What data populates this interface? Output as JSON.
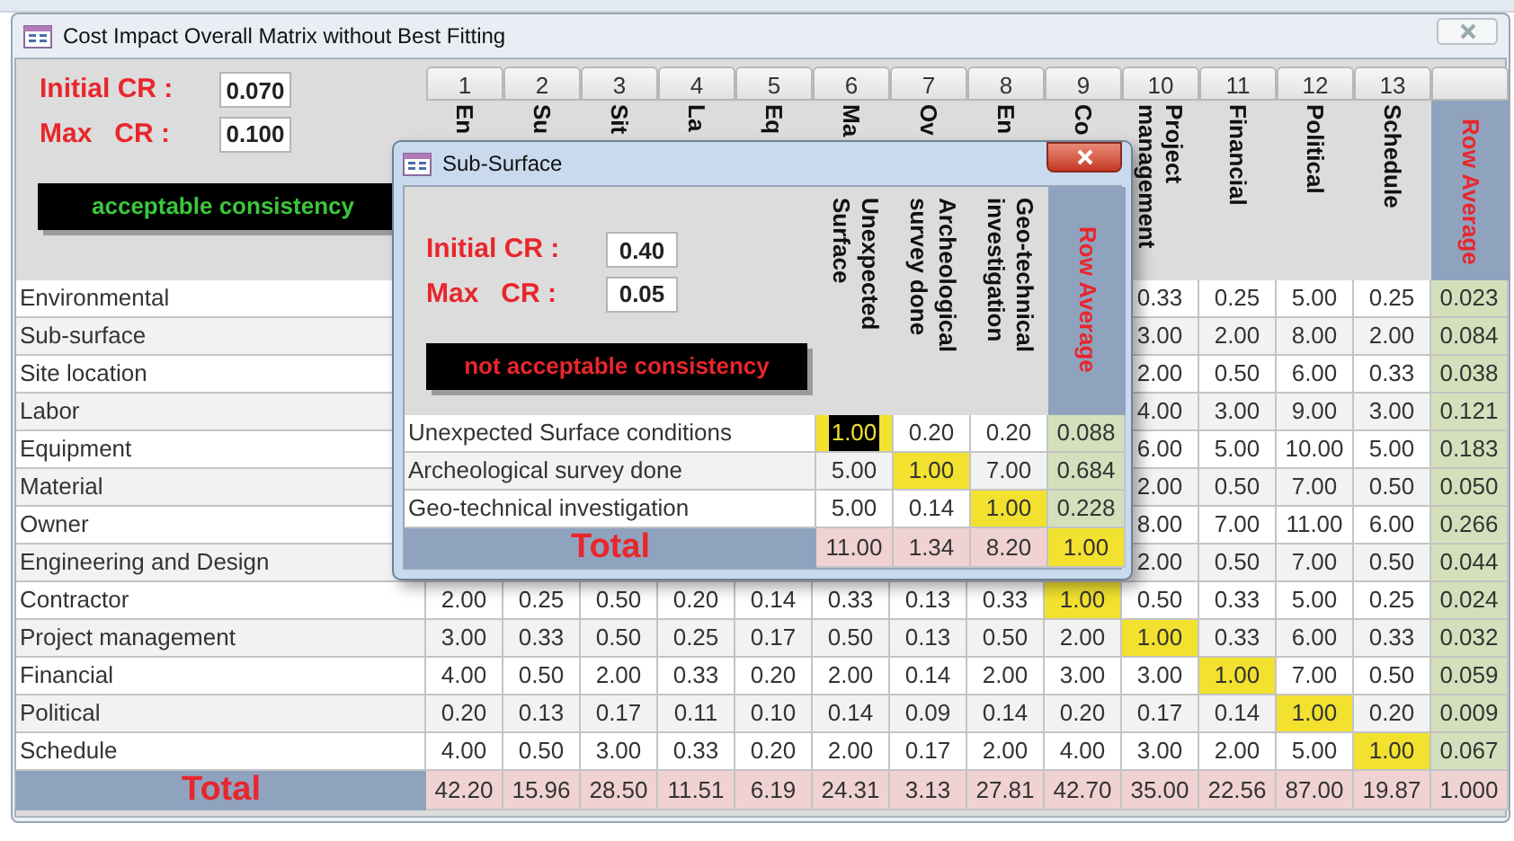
{
  "main_window": {
    "title": "Cost Impact Overall Matrix without Best Fitting",
    "initial_cr": {
      "label": "Initial CR :",
      "value": "0.070"
    },
    "max_cr": {
      "label": "Max   CR :",
      "value": "0.100"
    },
    "status": {
      "text": "acceptable consistency",
      "acceptable": true
    },
    "column_numbers": [
      "1",
      "2",
      "3",
      "4",
      "5",
      "6",
      "7",
      "8",
      "9",
      "10",
      "11",
      "12",
      "13"
    ],
    "columns": [
      "En",
      "Su",
      "Sit",
      "La",
      "Eq",
      "Ma",
      "Ov",
      "En",
      "Co",
      "Project management",
      "Financial",
      "Political",
      "Schedule"
    ],
    "average_header": "Row Average",
    "rows": [
      {
        "label": "Environmental",
        "cells": [
          null,
          null,
          null,
          null,
          null,
          null,
          null,
          null,
          null,
          "0.33",
          "0.25",
          "5.00",
          "0.25"
        ],
        "average": "0.023"
      },
      {
        "label": "Sub-surface",
        "cells": [
          null,
          null,
          null,
          null,
          null,
          null,
          null,
          null,
          null,
          "3.00",
          "2.00",
          "8.00",
          "2.00"
        ],
        "average": "0.084"
      },
      {
        "label": "Site location",
        "cells": [
          null,
          null,
          null,
          null,
          null,
          null,
          null,
          null,
          null,
          "2.00",
          "0.50",
          "6.00",
          "0.33"
        ],
        "average": "0.038"
      },
      {
        "label": "Labor",
        "cells": [
          null,
          null,
          null,
          null,
          null,
          null,
          null,
          null,
          null,
          "4.00",
          "3.00",
          "9.00",
          "3.00"
        ],
        "average": "0.121"
      },
      {
        "label": "Equipment",
        "cells": [
          null,
          null,
          null,
          null,
          null,
          null,
          null,
          null,
          null,
          "6.00",
          "5.00",
          "10.00",
          "5.00"
        ],
        "average": "0.183"
      },
      {
        "label": "Material",
        "cells": [
          null,
          null,
          null,
          null,
          null,
          null,
          null,
          null,
          null,
          "2.00",
          "0.50",
          "7.00",
          "0.50"
        ],
        "average": "0.050"
      },
      {
        "label": "Owner",
        "cells": [
          null,
          null,
          null,
          null,
          null,
          null,
          null,
          null,
          null,
          "8.00",
          "7.00",
          "11.00",
          "6.00"
        ],
        "average": "0.266"
      },
      {
        "label": "Engineering and Design",
        "cells": [
          null,
          null,
          null,
          null,
          null,
          null,
          null,
          null,
          null,
          "2.00",
          "0.50",
          "7.00",
          "0.50"
        ],
        "average": "0.044"
      },
      {
        "label": "Contractor",
        "cells": [
          "2.00",
          "0.25",
          "0.50",
          "0.20",
          "0.14",
          "0.33",
          "0.13",
          "0.33",
          "1.00",
          "0.50",
          "0.33",
          "5.00",
          "0.25"
        ],
        "average": "0.024"
      },
      {
        "label": "Project management",
        "cells": [
          "3.00",
          "0.33",
          "0.50",
          "0.25",
          "0.17",
          "0.50",
          "0.13",
          "0.50",
          "2.00",
          "1.00",
          "0.33",
          "6.00",
          "0.33"
        ],
        "average": "0.032"
      },
      {
        "label": "Financial",
        "cells": [
          "4.00",
          "0.50",
          "2.00",
          "0.33",
          "0.20",
          "2.00",
          "0.14",
          "2.00",
          "3.00",
          "3.00",
          "1.00",
          "7.00",
          "0.50"
        ],
        "average": "0.059"
      },
      {
        "label": "Political",
        "cells": [
          "0.20",
          "0.13",
          "0.17",
          "0.11",
          "0.10",
          "0.14",
          "0.09",
          "0.14",
          "0.20",
          "0.17",
          "0.14",
          "1.00",
          "0.20"
        ],
        "average": "0.009"
      },
      {
        "label": "Schedule",
        "cells": [
          "4.00",
          "0.50",
          "3.00",
          "0.33",
          "0.20",
          "2.00",
          "0.17",
          "2.00",
          "4.00",
          "3.00",
          "2.00",
          "5.00",
          "1.00"
        ],
        "average": "0.067"
      }
    ],
    "total": {
      "label": "Total",
      "cells": [
        "42.20",
        "15.96",
        "28.50",
        "11.51",
        "6.19",
        "24.31",
        "3.13",
        "27.81",
        "42.70",
        "35.00",
        "22.56",
        "87.00",
        "19.87"
      ],
      "average": "1.000",
      "average_highlighted": false
    }
  },
  "dialog": {
    "title": "Sub-Surface",
    "initial_cr": {
      "label": "Initial CR :",
      "value": "0.40"
    },
    "max_cr": {
      "label": "Max   CR :",
      "value": "0.05"
    },
    "status": {
      "text": "not acceptable consistency",
      "acceptable": false
    },
    "columns": [
      "Unexpected Surface",
      "Archeological survey done",
      "Geo-technical investigation"
    ],
    "average_header": "Row Average",
    "rows": [
      {
        "label": "Unexpected Surface conditions",
        "cells": [
          {
            "value": "1.00",
            "selected": true
          },
          {
            "value": "0.20",
            "selected": false
          },
          {
            "value": "0.20",
            "selected": false
          }
        ],
        "average": "0.088"
      },
      {
        "label": "Archeological survey done",
        "cells": [
          {
            "value": "5.00",
            "selected": false
          },
          {
            "value": "1.00",
            "selected": false
          },
          {
            "value": "7.00",
            "selected": false
          }
        ],
        "average": "0.684"
      },
      {
        "label": "Geo-technical  investigation",
        "cells": [
          {
            "value": "5.00",
            "selected": false
          },
          {
            "value": "0.14",
            "selected": false
          },
          {
            "value": "1.00",
            "selected": false
          }
        ],
        "average": "0.228"
      }
    ],
    "total": {
      "label": "Total",
      "cells": [
        "11.00",
        "1.34",
        "8.20"
      ],
      "average": "1.00",
      "average_highlighted": true
    }
  }
}
